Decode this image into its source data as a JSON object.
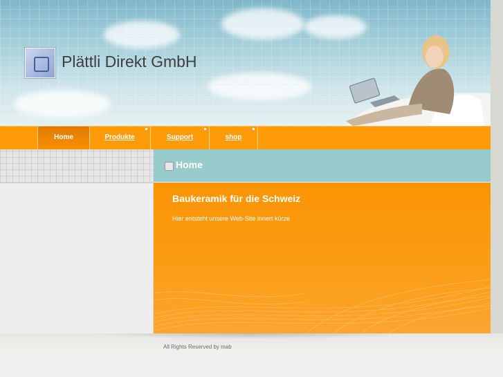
{
  "header": {
    "company_name": "Plättli Direkt GmbH",
    "logo_icon": "company-logo-icon",
    "hero_image": "woman-with-laptop"
  },
  "nav": {
    "items": [
      {
        "label": "Home",
        "active": true
      },
      {
        "label": "Produkte",
        "active": false
      },
      {
        "label": "Support",
        "active": false
      },
      {
        "label": "shop",
        "active": false
      }
    ]
  },
  "page": {
    "title": "Home",
    "title_icon": "page-icon",
    "heading": "Baukeramik für die Schweiz",
    "text": "Hier entsteht unsere Web-Site innert kürze"
  },
  "footer": {
    "text": "All Rights Reserved by mab"
  },
  "colors": {
    "nav_orange": "#ff9a08",
    "title_bar_teal": "#98cbcb",
    "content_orange": "#fb9404"
  }
}
